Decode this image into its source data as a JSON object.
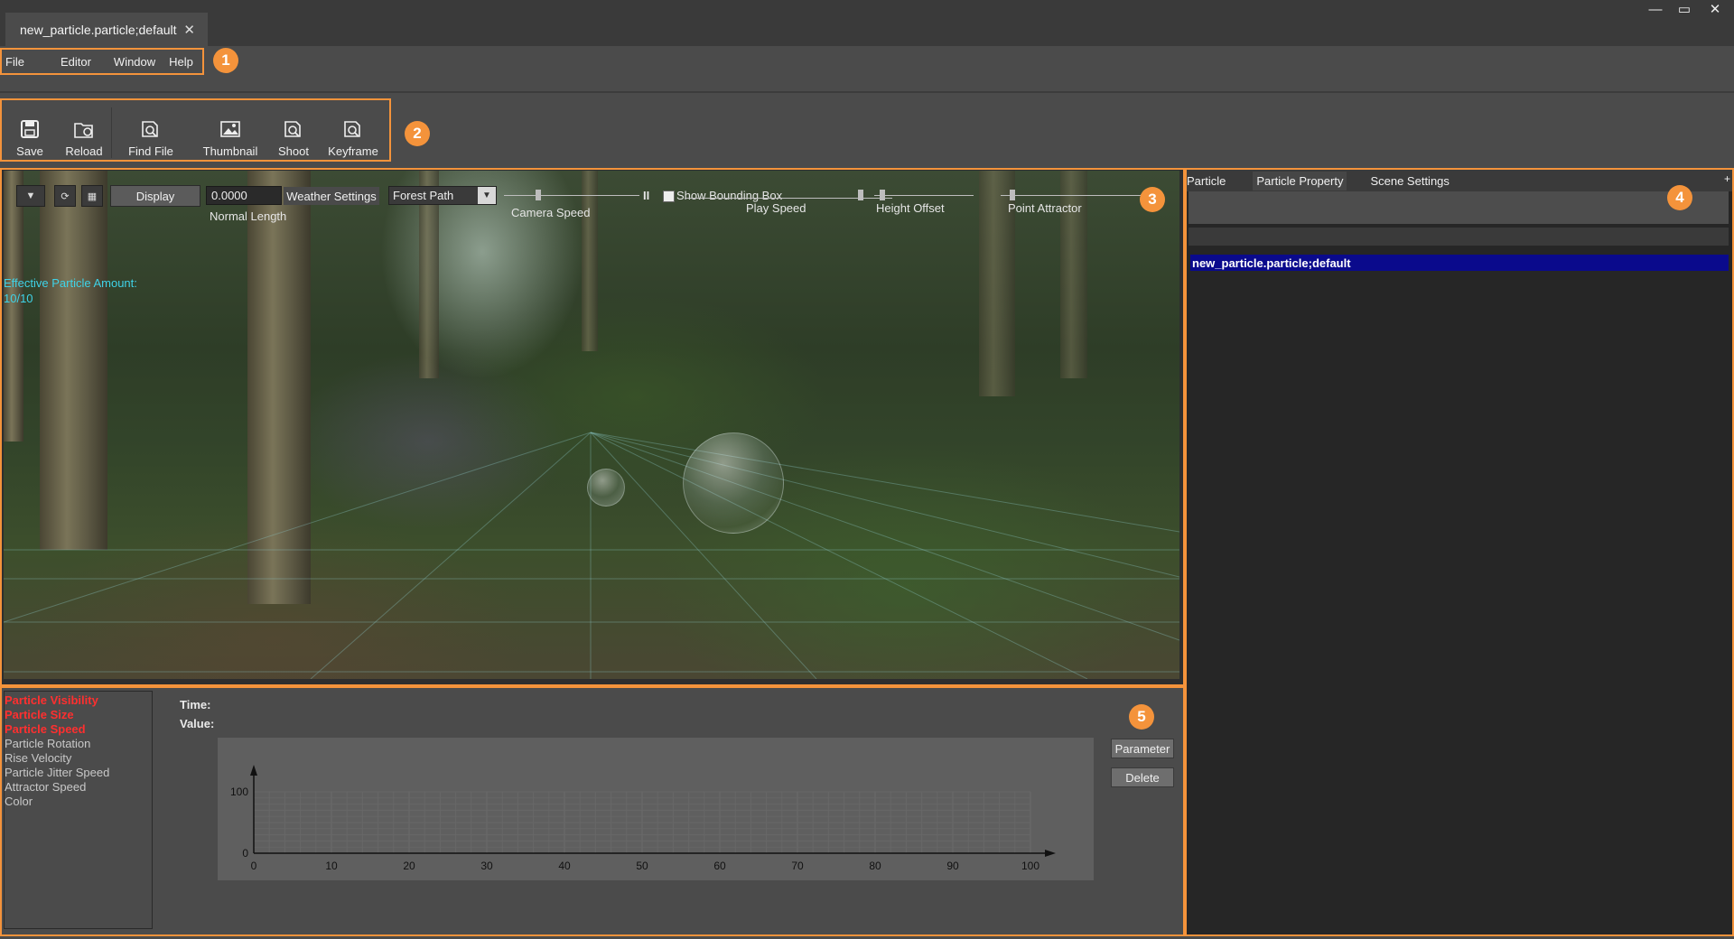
{
  "window": {
    "tab_title": "new_particle.particle;default",
    "controls": {
      "minimize": "—",
      "maximize": "▭",
      "close": "✕"
    }
  },
  "menu": {
    "items": [
      "File",
      "Editor",
      "Window",
      "Help"
    ]
  },
  "toolbar": {
    "buttons": [
      {
        "label": "Save",
        "icon": "save-icon"
      },
      {
        "label": "Reload",
        "icon": "reload-icon"
      },
      {
        "label": "Find File",
        "icon": "find-file-icon"
      },
      {
        "label": "Thumbnail",
        "icon": "thumbnail-icon"
      },
      {
        "label": "Shoot",
        "icon": "shoot-icon"
      },
      {
        "label": "Keyframe",
        "icon": "keyframe-icon"
      }
    ]
  },
  "viewport": {
    "display_label": "Display",
    "normal_length_value": "0.0000",
    "normal_length_label": "Normal Length",
    "weather_settings_label": "Weather Settings",
    "scene_select_value": "Forest Path",
    "camera_speed_label": "Camera Speed",
    "pause_symbol": "II",
    "show_bounding_box_label": "Show Bounding Box",
    "play_speed_label": "Play Speed",
    "height_offset_label": "Height Offset",
    "point_attractor_label": "Point Attractor",
    "effective_particle_label": "Effective Particle Amount:",
    "effective_particle_value": "10/10"
  },
  "right_panel": {
    "tabs": [
      "Particle",
      "Particle Property",
      "Scene Settings"
    ],
    "tree_item": "new_particle.particle;default"
  },
  "curve_editor": {
    "parameters": [
      {
        "label": "Particle Visibility",
        "active": true
      },
      {
        "label": "Particle Size",
        "active": true
      },
      {
        "label": "Particle Speed",
        "active": true
      },
      {
        "label": "Particle Rotation",
        "active": false
      },
      {
        "label": "Rise Velocity",
        "active": false
      },
      {
        "label": "Particle Jitter Speed",
        "active": false
      },
      {
        "label": "Attractor Speed",
        "active": false
      },
      {
        "label": "Color",
        "active": false
      }
    ],
    "time_label": "Time:",
    "value_label": "Value:",
    "parameter_button": "Parameter",
    "delete_button": "Delete",
    "chart": {
      "x_ticks": [
        "0",
        "10",
        "20",
        "30",
        "40",
        "50",
        "60",
        "70",
        "80",
        "90",
        "100"
      ],
      "y_ticks": [
        "100",
        "0"
      ]
    }
  },
  "annotations": [
    "1",
    "2",
    "3",
    "4",
    "5"
  ],
  "colors": {
    "accent_orange": "#f4933b",
    "selection_blue": "#0a0a8c",
    "active_param_red": "#ff2f2f",
    "overlay_cyan": "#3fd3e8"
  }
}
